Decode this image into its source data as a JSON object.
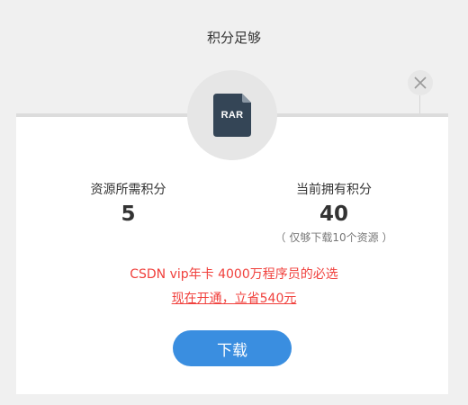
{
  "dialog": {
    "title": "积分足够",
    "file_type": "RAR"
  },
  "points": {
    "required_label": "资源所需积分",
    "required_value": "5",
    "current_label": "当前拥有积分",
    "current_value": "40",
    "current_note": "（ 仅够下载10个资源 ）"
  },
  "promo": {
    "line1": "CSDN vip年卡   4000万程序员的必选",
    "line2": "现在开通，立省540元"
  },
  "actions": {
    "download_label": "下载"
  },
  "colors": {
    "accent": "#3a8ee0",
    "promo": "#f0403c",
    "file_icon": "#344556"
  }
}
